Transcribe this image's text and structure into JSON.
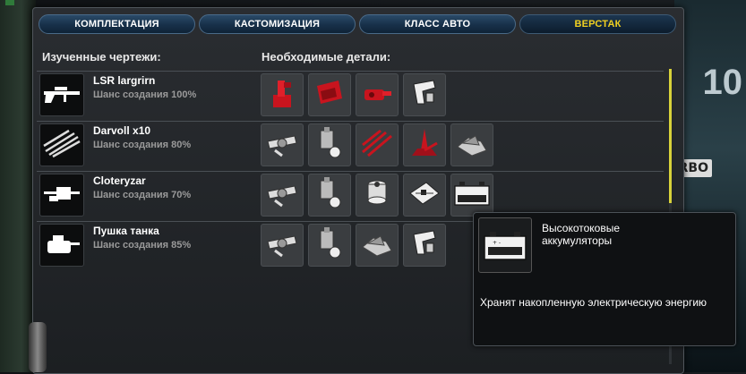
{
  "background": {
    "badge": "10",
    "plate": "TRBO"
  },
  "tabs": [
    {
      "label": "КОМПЛЕКТАЦИЯ",
      "active": false
    },
    {
      "label": "КАСТОМИЗАЦИЯ",
      "active": false
    },
    {
      "label": "КЛАСС АВТО",
      "active": false
    },
    {
      "label": "ВЕРСТАК",
      "active": true
    }
  ],
  "colors": {
    "accent": "#f0d020",
    "tab_bg": "#173049",
    "part_red": "#c8141e"
  },
  "headers": {
    "learned": "Изученные чертежи:",
    "required": "Необходимые детали:"
  },
  "blueprints": [
    {
      "name": "LSR largrirn",
      "chance": "Шанс создания 100%",
      "thumb_icon": "sniper-rifle-icon",
      "parts": [
        "red-gun-mount-icon",
        "red-armor-plate-icon",
        "red-turret-icon",
        "gun-frame-icon"
      ]
    },
    {
      "name": "Darvoll x10",
      "chance": "Шанс создания 80%",
      "thumb_icon": "rocket-pod-icon",
      "parts": [
        "servo-module-icon",
        "hydraulic-block-icon",
        "red-rockets-icon",
        "red-launcher-icon",
        "metal-scrap-icon"
      ]
    },
    {
      "name": "Cloteryzar",
      "chance": "Шанс создания 70%",
      "thumb_icon": "laser-cannon-icon",
      "parts": [
        "servo-module-icon",
        "hydraulic-block-icon",
        "wire-spool-icon",
        "circuit-board-icon",
        "car-battery-icon"
      ]
    },
    {
      "name": "Пушка танка",
      "chance": "Шанс создания 85%",
      "thumb_icon": "tank-turret-icon",
      "parts": [
        "servo-module-icon",
        "hydraulic-block-icon",
        "metal-scrap-icon",
        "gun-frame-icon"
      ]
    }
  ],
  "tooltip": {
    "icon": "car-battery-icon",
    "title": "Высокотоковые аккумуляторы",
    "description": "Хранят накопленную электрическую энергию"
  }
}
